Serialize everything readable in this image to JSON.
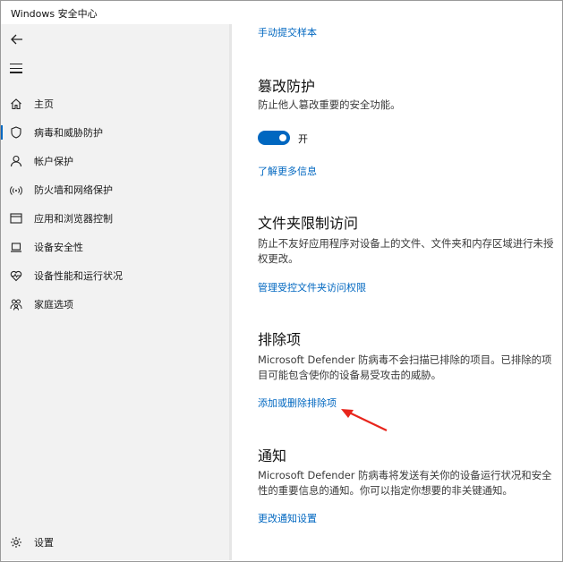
{
  "window": {
    "title": "Windows 安全中心"
  },
  "nav": {
    "back_icon": "back-arrow-icon",
    "menu_icon": "hamburger-icon",
    "items": [
      {
        "label": "主页",
        "icon": "home-icon"
      },
      {
        "label": "病毒和威胁防护",
        "icon": "shield-icon",
        "active": true
      },
      {
        "label": "帐户保护",
        "icon": "person-icon"
      },
      {
        "label": "防火墙和网络保护",
        "icon": "wifi-icon"
      },
      {
        "label": "应用和浏览器控制",
        "icon": "browser-icon"
      },
      {
        "label": "设备安全性",
        "icon": "laptop-icon"
      },
      {
        "label": "设备性能和运行状况",
        "icon": "heart-icon"
      },
      {
        "label": "家庭选项",
        "icon": "family-icon"
      }
    ],
    "settings": {
      "label": "设置",
      "icon": "gear-icon"
    }
  },
  "content": {
    "submit_sample_link": "手动提交样本",
    "tamper": {
      "title": "篡改防护",
      "desc": "防止他人篡改重要的安全功能。",
      "toggle_state": "开",
      "toggle_on": true,
      "learn_more_link": "了解更多信息"
    },
    "folder_access": {
      "title": "文件夹限制访问",
      "desc": "防止不友好应用程序对设备上的文件、文件夹和内存区域进行未授权更改。",
      "link": "管理受控文件夹访问权限"
    },
    "exclusions": {
      "title": "排除项",
      "desc": "Microsoft Defender 防病毒不会扫描已排除的项目。已排除的项目可能包含使你的设备易受攻击的威胁。",
      "link": "添加或删除排除项"
    },
    "notifications": {
      "title": "通知",
      "desc": "Microsoft Defender 防病毒将发送有关你的设备运行状况和安全性的重要信息的通知。你可以指定你想要的非关键通知。",
      "link": "更改通知设置"
    }
  },
  "colors": {
    "accent": "#0067c0",
    "annotation_arrow": "#e8251c",
    "sidebar_bg": "#f2f2f2"
  }
}
